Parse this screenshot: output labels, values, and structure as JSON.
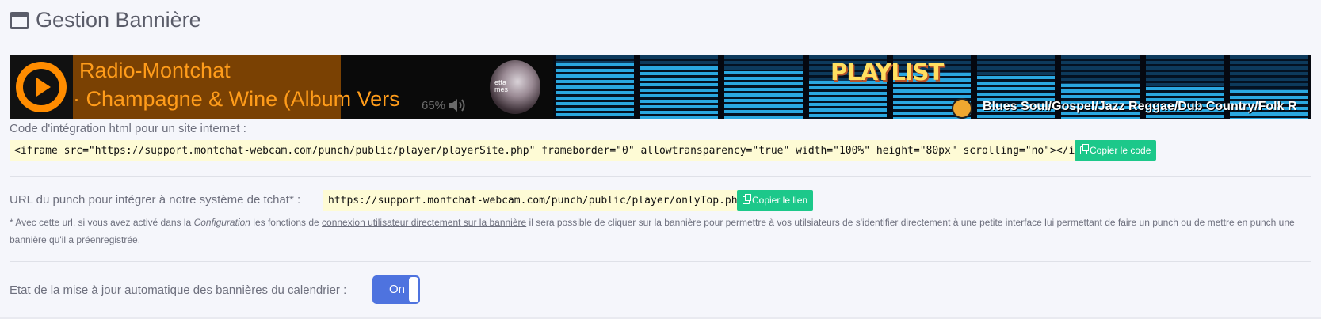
{
  "page": {
    "title": "Gestion Bannière"
  },
  "banner": {
    "station": "Radio-Montchat",
    "track": "· Champagne & Wine (Album Vers",
    "volume": "65%",
    "cover_text": "etta\nmes",
    "playlist_label": "PLAYLIST",
    "genres": "Blues Soul/Gospel/Jazz Reggae/Dub Country/Folk R",
    "eq_levels": [
      0.88,
      0.82,
      0.75,
      0.6,
      0.72,
      0.68,
      0.55,
      0.5,
      0.45
    ],
    "colors": {
      "accent": "#ff8c00",
      "bar": "#2aa7e0"
    }
  },
  "embed": {
    "label": "Code d'intégration html pour un site internet :",
    "code": "<iframe src=\"https://support.montchat-webcam.com/punch/public/player/playerSite.php\" frameborder=\"0\" allowtransparency=\"true\" width=\"100%\" height=\"80px\" scrolling=\"no\"></iframe>",
    "copy_label": "Copier le code"
  },
  "punch": {
    "label": "URL du punch pour intégrer à notre système de tchat* :",
    "url": "https://support.montchat-webcam.com/punch/public/player/onlyTop.php",
    "copy_label": "Copier le lien",
    "note_prefix": "* Avec cette url, si vous avez activé dans la ",
    "note_config": "Configuration",
    "note_mid": " les fonctions de ",
    "note_link": "connexion utilisateur directement sur la bannière",
    "note_suffix": " il sera possible de cliquer sur la bannière pour permettre à vos utilsiateurs de s'identifier directement à une petite interface lui permettant de faire un punch ou de mettre en punch une bannière qu'il a préenregistrée."
  },
  "auto_update": {
    "label": "Etat de la mise à jour automatique des bannières du calendrier :",
    "toggle_label": "On",
    "state": true
  }
}
